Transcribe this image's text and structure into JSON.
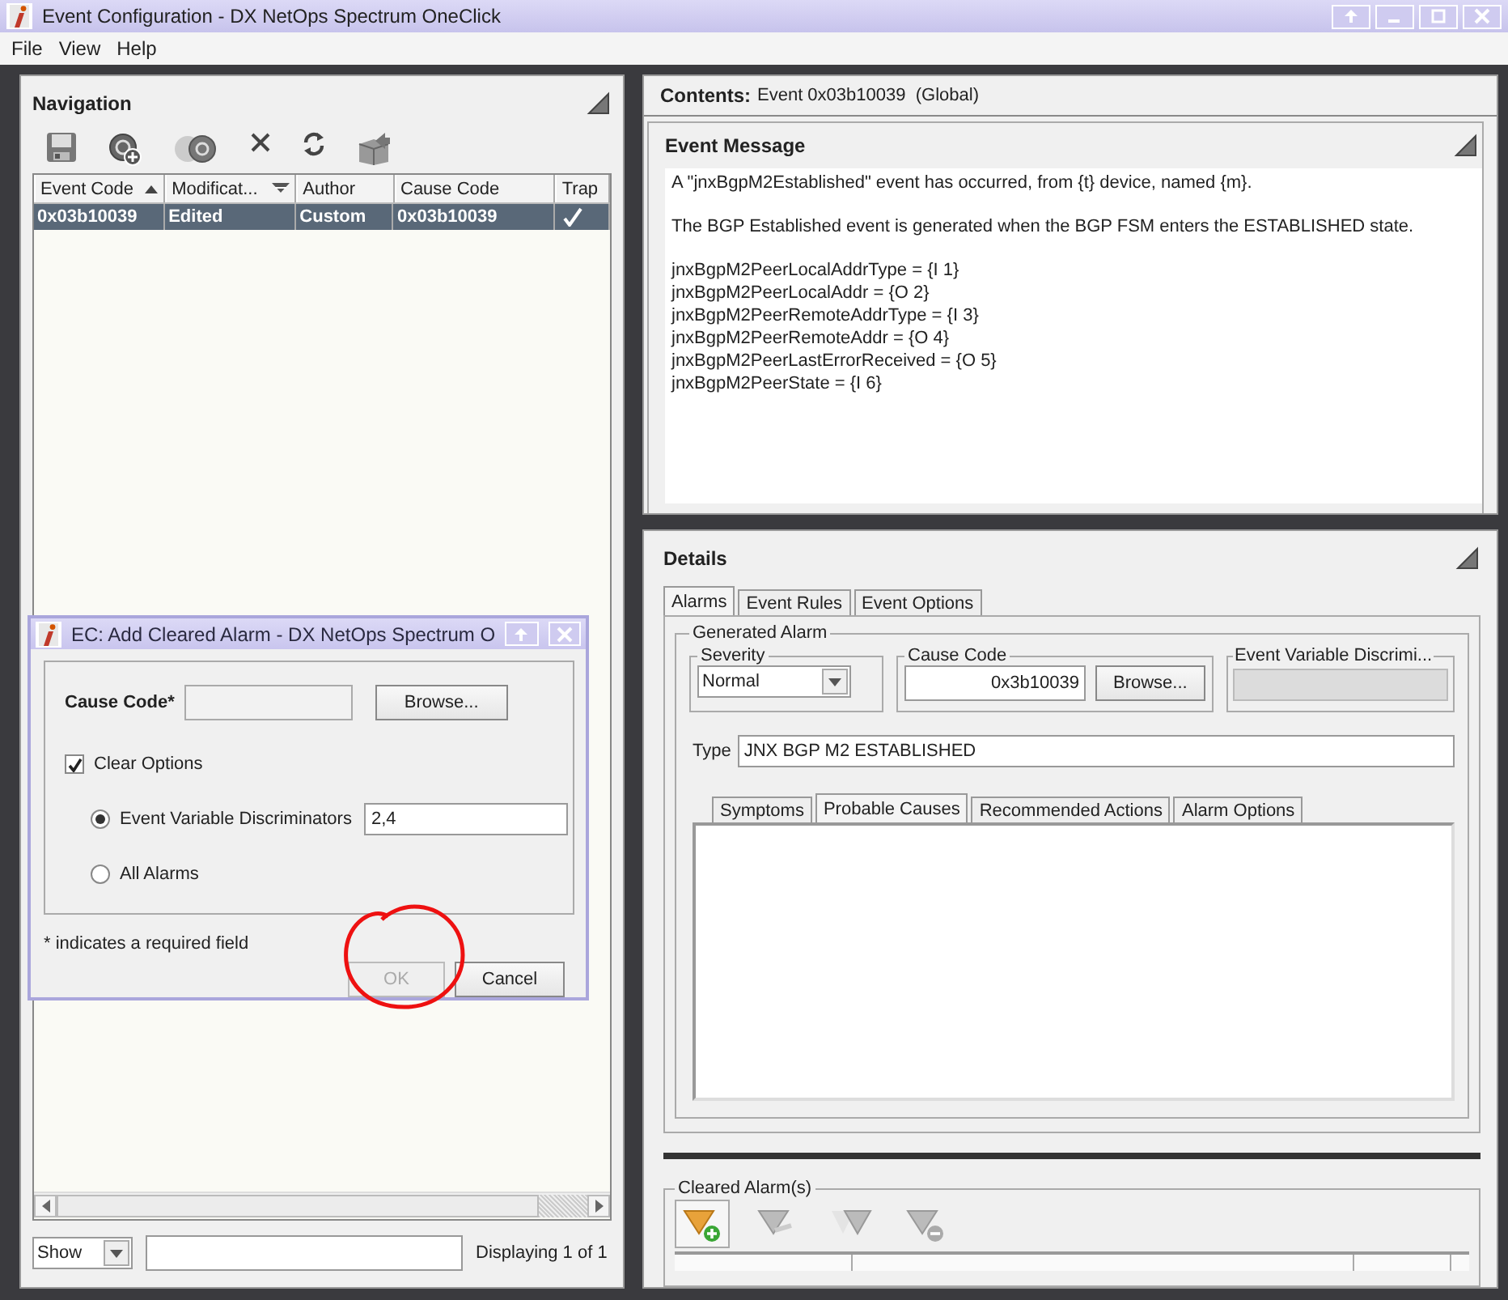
{
  "window": {
    "title": "Event Configuration - DX NetOps Spectrum OneClick"
  },
  "menu": [
    {
      "label": "File"
    },
    {
      "label": "View"
    },
    {
      "label": "Help"
    }
  ],
  "navigation": {
    "title": "Navigation",
    "table": {
      "columns": [
        {
          "label": "Event Code",
          "sort_ascending": true,
          "sort_descending": false
        },
        {
          "label": "Modificat...",
          "sort_ascending": false,
          "sort_descending": true
        },
        {
          "label": "Author",
          "sort_ascending": false,
          "sort_descending": false
        },
        {
          "label": "Cause Code",
          "sort_ascending": false,
          "sort_descending": false
        },
        {
          "label": "Trap",
          "sort_ascending": false,
          "sort_descending": false
        }
      ],
      "rows": [
        {
          "event_code": "0x03b10039",
          "modification": "Edited",
          "author": "Custom",
          "cause_code": "0x03b10039",
          "trap": true,
          "selected": true
        }
      ]
    },
    "filter_mode": "Show",
    "status": "Displaying 1 of 1"
  },
  "contents": {
    "label": "Contents:",
    "value": "Event 0x03b10039  (Global)"
  },
  "event_message": {
    "title": "Event Message",
    "paragraphs": [
      "A \"jnxBgpM2Established\" event has occurred, from {t} device, named {m}.",
      "The BGP Established event is generated when the BGP FSM enters the ESTABLISHED state.",
      "jnxBgpM2PeerLocalAddrType = {I 1}\njnxBgpM2PeerLocalAddr = {O 2}\njnxBgpM2PeerRemoteAddrType = {I 3}\njnxBgpM2PeerRemoteAddr = {O 4}\njnxBgpM2PeerLastErrorReceived = {O 5}\njnxBgpM2PeerState = {I 6}"
    ]
  },
  "details": {
    "title": "Details",
    "tabs": [
      {
        "label": "Alarms",
        "selected": true
      },
      {
        "label": "Event Rules",
        "selected": false
      },
      {
        "label": "Event Options",
        "selected": false
      }
    ],
    "generated_alarm": {
      "legend": "Generated Alarm",
      "severity": {
        "legend": "Severity",
        "value": "Normal"
      },
      "cause_code": {
        "legend": "Cause Code",
        "value": "0x3b10039",
        "button": "Browse..."
      },
      "discriminators": {
        "legend": "Event Variable Discrimi...",
        "disabled": true
      },
      "type": {
        "label": "Type",
        "value": "JNX BGP M2 ESTABLISHED"
      },
      "subtabs": [
        {
          "label": "Symptoms",
          "selected": false
        },
        {
          "label": "Probable Causes",
          "selected": true
        },
        {
          "label": "Recommended Actions",
          "selected": false
        },
        {
          "label": "Alarm Options",
          "selected": false
        }
      ]
    },
    "cleared_alarms": {
      "legend": "Cleared Alarm(s)",
      "tools": [
        {
          "disabled": false
        },
        {
          "disabled": true
        },
        {
          "disabled": true
        },
        {
          "disabled": true
        }
      ]
    }
  },
  "dialog": {
    "title": "EC: Add Cleared Alarm - DX NetOps Spectrum O",
    "cause_code": {
      "label": "Cause Code*",
      "button": "Browse..."
    },
    "clear_options": {
      "label": "Clear Options",
      "checked": true
    },
    "options": [
      {
        "label": "Event Variable Discriminators",
        "selected": true,
        "value": "2,4"
      },
      {
        "label": "All Alarms",
        "selected": false
      }
    ],
    "note": "* indicates a required field",
    "buttons": [
      {
        "label": "OK",
        "disabled": true
      },
      {
        "label": "Cancel",
        "disabled": false
      }
    ]
  }
}
